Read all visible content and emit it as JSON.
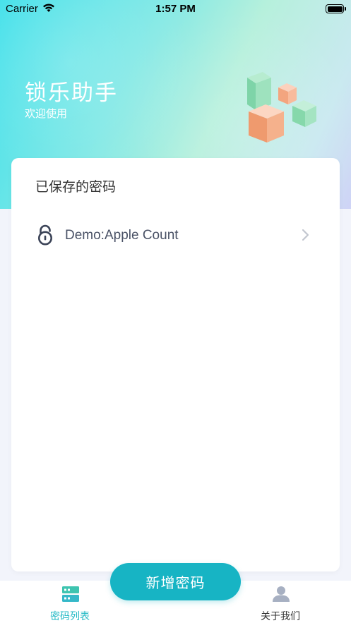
{
  "status_bar": {
    "carrier": "Carrier",
    "time": "1:57 PM"
  },
  "header": {
    "title": "锁乐助手",
    "subtitle": "欢迎使用",
    "illustration": "cubes-icon"
  },
  "saved_passwords": {
    "section_title": "已保存的密码",
    "items": [
      {
        "label": "Demo:Apple Count",
        "icon": "lock-icon"
      }
    ]
  },
  "add_button": {
    "label": "新增密码"
  },
  "tabbar": {
    "tabs": [
      {
        "label": "密码列表",
        "icon": "list-icon",
        "active": true
      },
      {
        "label": "关于我们",
        "icon": "user-icon",
        "active": false
      }
    ]
  },
  "colors": {
    "accent": "#17b4c4",
    "active_tab": "#1fb8c4",
    "icon_gray": "#a7b0c2"
  }
}
